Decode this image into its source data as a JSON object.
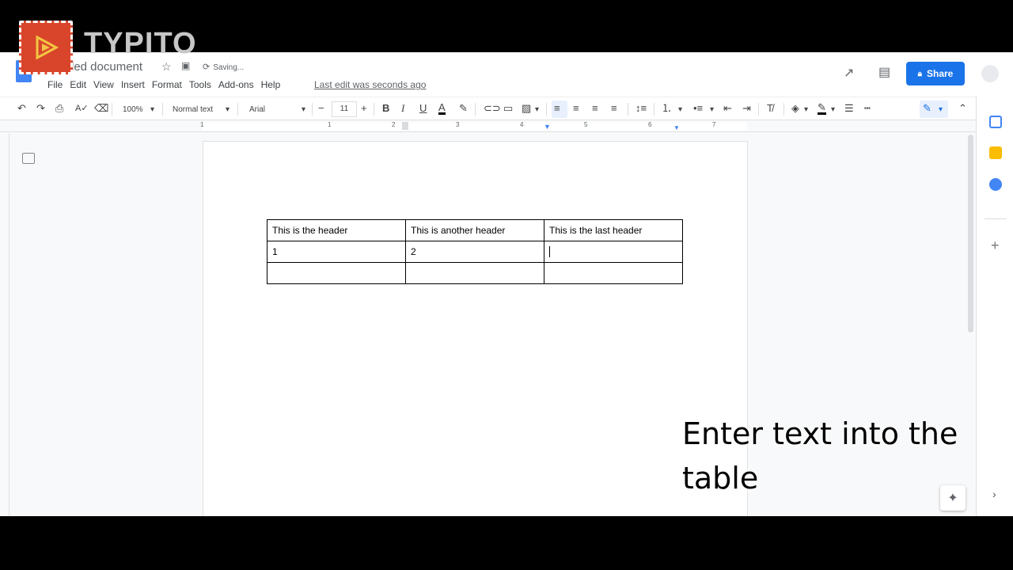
{
  "watermark": {
    "brand": "TYPITO"
  },
  "header": {
    "title": "led document",
    "saving": "Saving...",
    "menu": [
      "File",
      "Edit",
      "View",
      "Insert",
      "Format",
      "Tools",
      "Add-ons",
      "Help"
    ],
    "last_edit": "Last edit was seconds ago",
    "share_label": "Share"
  },
  "toolbar": {
    "zoom": "100%",
    "style": "Normal text",
    "font": "Arial",
    "font_size": "11"
  },
  "ruler": {
    "numbers": [
      "1",
      "1",
      "2",
      "3",
      "4",
      "5",
      "6",
      "7"
    ]
  },
  "table": {
    "headers": [
      "This is the header",
      "This is another header",
      "This is the last header"
    ],
    "row1": [
      "1",
      "2",
      ""
    ],
    "row2": [
      "",
      "",
      ""
    ]
  },
  "caption": {
    "text": "Enter text into the table"
  },
  "colors": {
    "accent": "#1a73e8",
    "brand": "#d8452b"
  }
}
